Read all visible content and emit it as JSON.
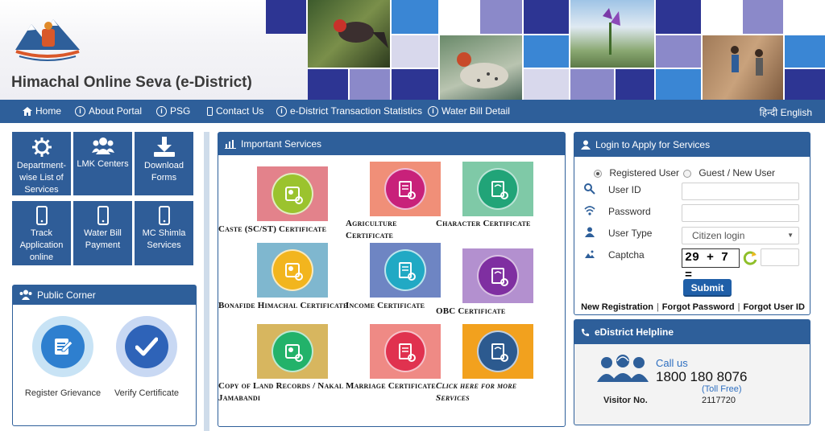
{
  "header": {
    "title": "Himachal Online Seva (e-District)",
    "colors": {
      "navy": "#2d3593",
      "blue": "#3a86d4",
      "lavender": "#8b89c9",
      "pale": "#d8d8ec"
    }
  },
  "nav": {
    "items": [
      {
        "label": "Home",
        "icon": "home-icon"
      },
      {
        "label": "About Portal",
        "icon": "info-icon"
      },
      {
        "label": "PSG",
        "icon": "info-icon"
      },
      {
        "label": "Contact Us",
        "icon": "phone-icon"
      },
      {
        "label": "e-District Transaction Statistics",
        "icon": "info-icon"
      },
      {
        "label": "Water Bill Detail",
        "icon": "info-icon"
      }
    ],
    "lang_hindi": "हिन्दी",
    "lang_english": "English"
  },
  "quick_links": [
    {
      "label": "Department-wise List of Services",
      "icon": "gear-icon"
    },
    {
      "label": "LMK Centers",
      "icon": "users-icon"
    },
    {
      "label": "Download Forms",
      "icon": "download-icon"
    },
    {
      "label": "Track Application online",
      "icon": "mobile-icon"
    },
    {
      "label": "Water Bill Payment",
      "icon": "mobile-icon"
    },
    {
      "label": "MC Shimla Services",
      "icon": "mobile-icon"
    }
  ],
  "public_corner": {
    "title": "Public Corner",
    "items": [
      {
        "label": "Register Grievance",
        "icon": "edit-form-icon"
      },
      {
        "label": "Verify Certificate",
        "icon": "checkmark-icon"
      }
    ]
  },
  "services": {
    "title": "Important Services",
    "items": [
      {
        "label": "Caste (SC/ST) Certificate",
        "bg": "#e3828b",
        "circle": "#9bc32e"
      },
      {
        "label": "Agriculture Certificate",
        "bg": "#f08f78",
        "circle": "#c8217a"
      },
      {
        "label": "Character Certificate",
        "bg": "#7fc9a7",
        "circle": "#21a478"
      },
      {
        "label": "Bonafide Himachal Certificate",
        "bg": "#7fb7cf",
        "circle": "#f2b51e"
      },
      {
        "label": "Income Certificate",
        "bg": "#6e85c3",
        "circle": "#21a9c4"
      },
      {
        "label": "OBC Certificate",
        "bg": "#b390cf",
        "circle": "#7f2fa1"
      },
      {
        "label": "Copy of Land Records / Nakal Jamabandi",
        "bg": "#d7b65f",
        "circle": "#22b26a"
      },
      {
        "label": "Marriage Certificate",
        "bg": "#ef8a85",
        "circle": "#e0324f"
      },
      {
        "label": "Click here for more Services",
        "bg": "#f2a11e",
        "circle": "#2c5a8f"
      }
    ]
  },
  "login": {
    "title": "Login to Apply for Services",
    "radio_registered": "Registered User",
    "radio_guest": "Guest / New User",
    "user_id_label": "User ID",
    "password_label": "Password",
    "user_type_label": "User Type",
    "user_type_value": "Citizen login",
    "captcha_label": "Captcha",
    "captcha_text": "29 + 7 =",
    "submit": "Submit",
    "links": [
      "New Registration",
      "Forgot Password",
      "Forgot User ID"
    ]
  },
  "helpline": {
    "title": "eDistrict Helpline",
    "call_us": "Call us",
    "number": "1800 180 8076",
    "toll_free": "(Toll Free)",
    "visitor_label": "Visitor No.",
    "visitor_count": "2117720"
  }
}
